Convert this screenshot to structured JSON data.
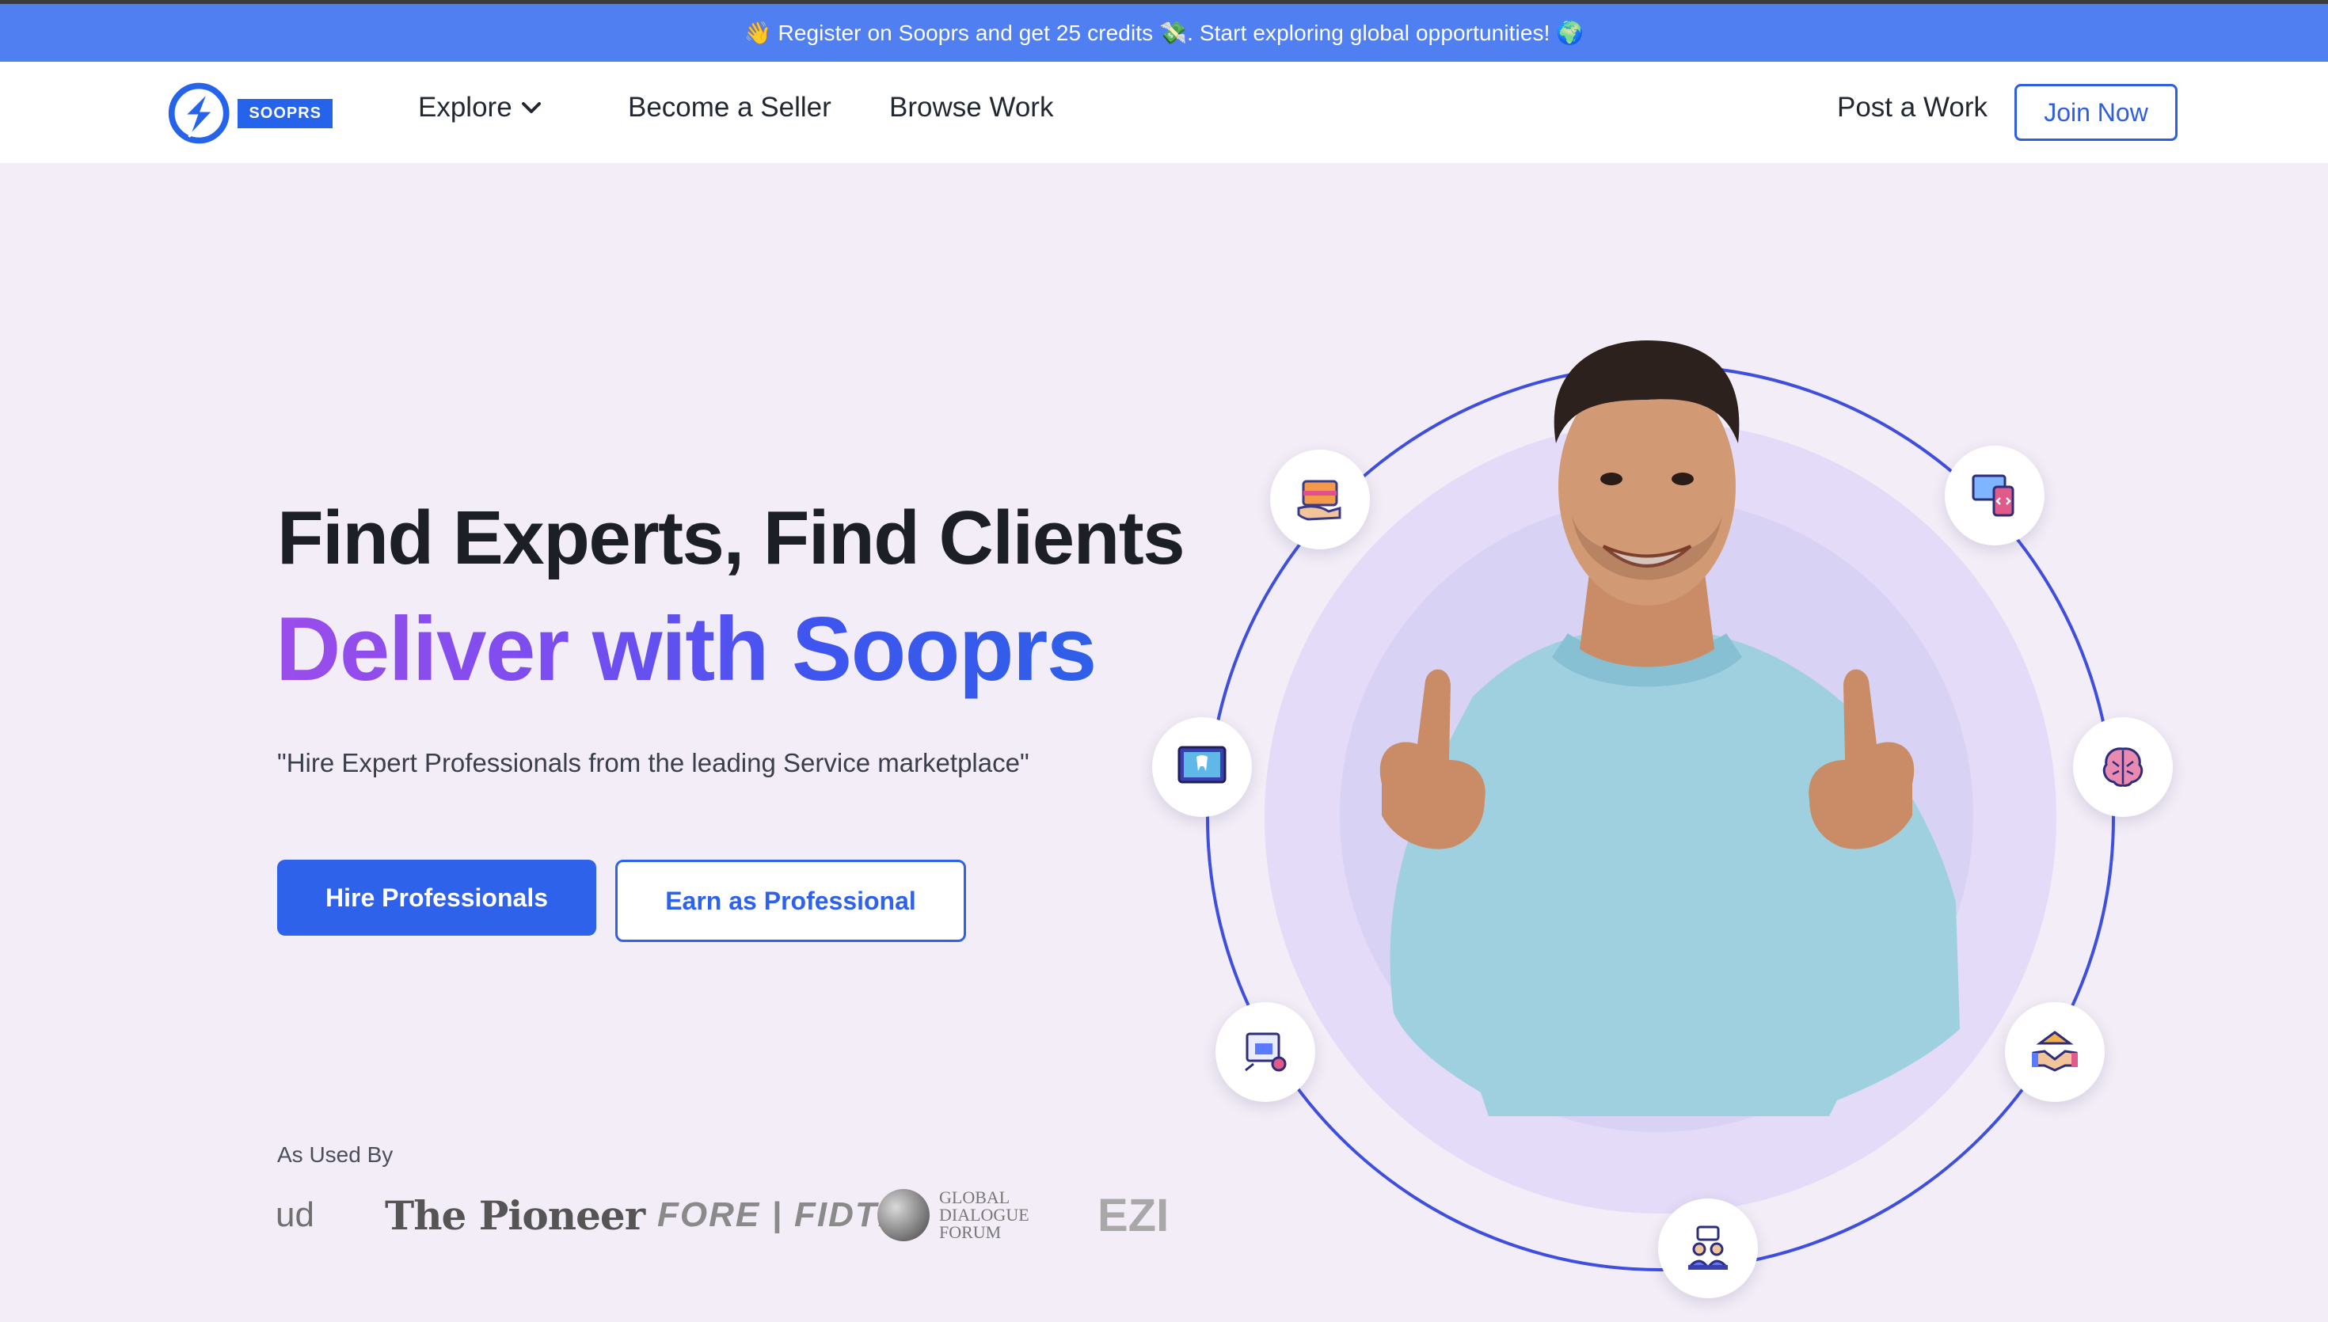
{
  "announcement": {
    "text": "👋 Register on Sooprs and get 25 credits 💸. Start exploring global opportunities! 🌍"
  },
  "nav": {
    "brand": "SOOPRS",
    "explore": "Explore",
    "become_seller": "Become a Seller",
    "browse_work": "Browse Work",
    "post_work": "Post a Work",
    "join_now": "Join Now"
  },
  "hero": {
    "title": "Find Experts, Find Clients",
    "gradient_title": "Deliver with Sooprs",
    "subtitle": "\"Hire Expert Professionals from the leading Service marketplace\"",
    "primary_cta": "Hire Professionals",
    "secondary_cta": "Earn as Professional"
  },
  "used_by": {
    "label": "As Used By",
    "brands": {
      "ud": "ud",
      "pioneer": "The Pioneer",
      "fore": "FORE | FIDTR",
      "gdf_line1": "GLOBAL",
      "gdf_line2": "DIALOGUE",
      "gdf_line3": "FORUM",
      "ezi": "EZI"
    }
  },
  "colors": {
    "banner": "#4f7ff0",
    "primary": "#2f62ea",
    "background": "#f3edf7",
    "orbit": "#3e4fe0",
    "gradient_start": "#9b4dea",
    "gradient_end": "#2f5fe8"
  },
  "orbit_icons": [
    "delivery-box-icon",
    "code-devices-icon",
    "dental-monitor-icon",
    "brain-icon",
    "ad-design-icon",
    "handshake-icon",
    "team-meeting-icon"
  ]
}
